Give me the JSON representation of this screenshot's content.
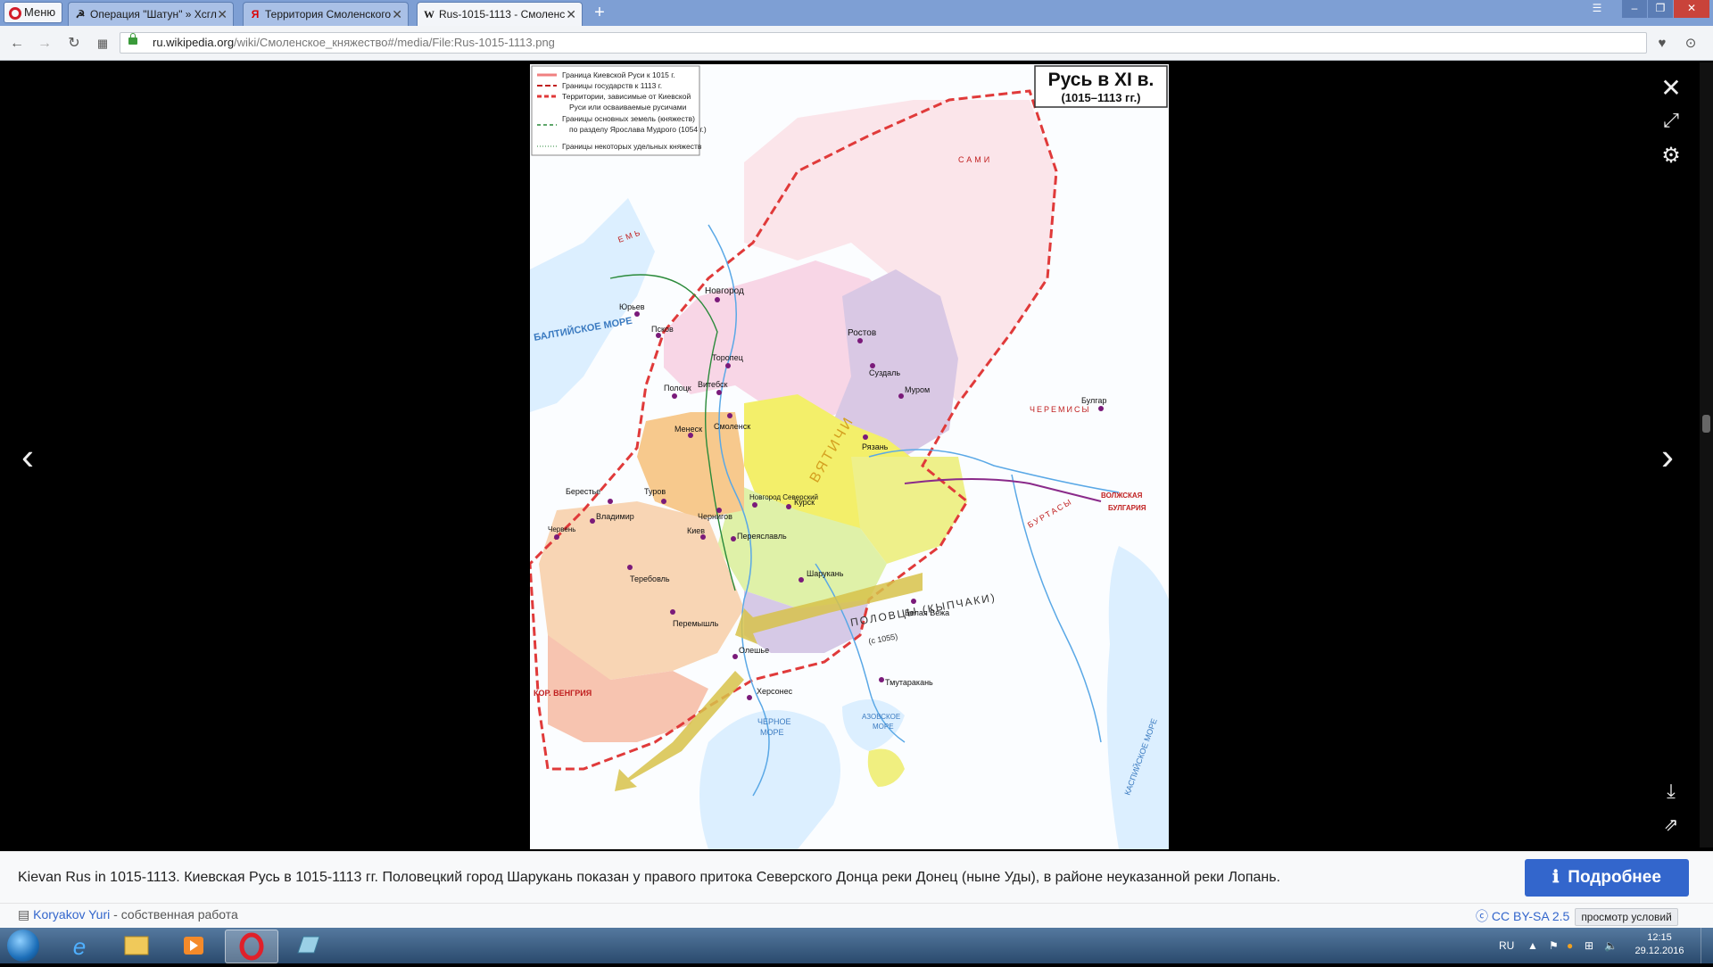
{
  "browser": {
    "menu_label": "Меню",
    "tabs": [
      {
        "title": "Операция \"Шатун\" » Хсгл",
        "icon": "hammer-sickle-icon"
      },
      {
        "title": "Территория Смоленского",
        "icon": "yandex-icon"
      },
      {
        "title": "Rus-1015-1113 - Смоленс",
        "icon": "wikipedia-icon"
      }
    ],
    "url_domain": "ru.wikipedia.org",
    "url_path": "/wiki/Смоленское_княжество#/media/File:Rus-1015-1113.png"
  },
  "map": {
    "title_line1": "Русь в XI в.",
    "title_line2": "(1015–1113 гг.)",
    "legend": [
      "Граница Киевской Руси к 1015 г.",
      "Границы государств к 1113 г.",
      "Территории, зависимые от Киевской",
      "Руси или осваиваемые русичами",
      "Границы основных земель (княжеств)",
      "по разделу Ярослава Мудрого (1054 г.)",
      "Границы некоторых удельных княжеств"
    ],
    "labels": {
      "baltic": "БАЛТИЙСКОЕ МОРЕ",
      "black_sea_1": "ЧЕРНОЕ",
      "black_sea_2": "МОРЕ",
      "azov_1": "АЗОВСКОЕ",
      "azov_2": "МОРЕ",
      "caspian": "КАСПИЙСКОЕ МОРЕ",
      "polovtsy": "ПОЛОВЦЫ (КЫПЧАКИ)",
      "since_1055": "(с 1055)",
      "volga_bulgaria_1": "ВОЛЖСКАЯ",
      "volga_bulgaria_2": "БУЛГАРИЯ",
      "hungary": "КОР. ВЕНГРИЯ",
      "saami": "САМИ",
      "yem": "ЕМЬ",
      "cheremisy": "ЧЕРЕМИСЫ",
      "burtasy": "БУРТАСЫ",
      "vyatichi": "ВЯТИЧИ"
    },
    "cities": [
      "Новгород",
      "Юрьев",
      "Псков",
      "Ростов",
      "Суздаль",
      "Торопец",
      "Полоцк",
      "Витебск",
      "Смоленск",
      "Муром",
      "Рязань",
      "Булгар",
      "Менеск",
      "Берестье",
      "Туров",
      "Чернигов",
      "Новгород Северский",
      "Курск",
      "Владимир",
      "Червень",
      "Киев",
      "Переяславль",
      "Шарукань",
      "Теребовль",
      "Перемышль",
      "Белая Вежа",
      "Олешье",
      "Херсонес",
      "Тмутаракань"
    ]
  },
  "caption": {
    "description": "Kievan Rus in 1015-1113. Киевская Русь в 1015-1113 гг. Половецкий город Шарукань показан у правого притока Северского Донца реки Донец (ныне Уды), в районе неуказанной реки Лопань.",
    "more_button": "Подробнее",
    "author": "Koryakov Yuri",
    "author_suffix": " - собственная работа",
    "license": "CC BY-SA 2.5",
    "terms": "просмотр условий"
  },
  "taskbar": {
    "language": "RU",
    "time": "12:15",
    "date": "29.12.2016"
  }
}
